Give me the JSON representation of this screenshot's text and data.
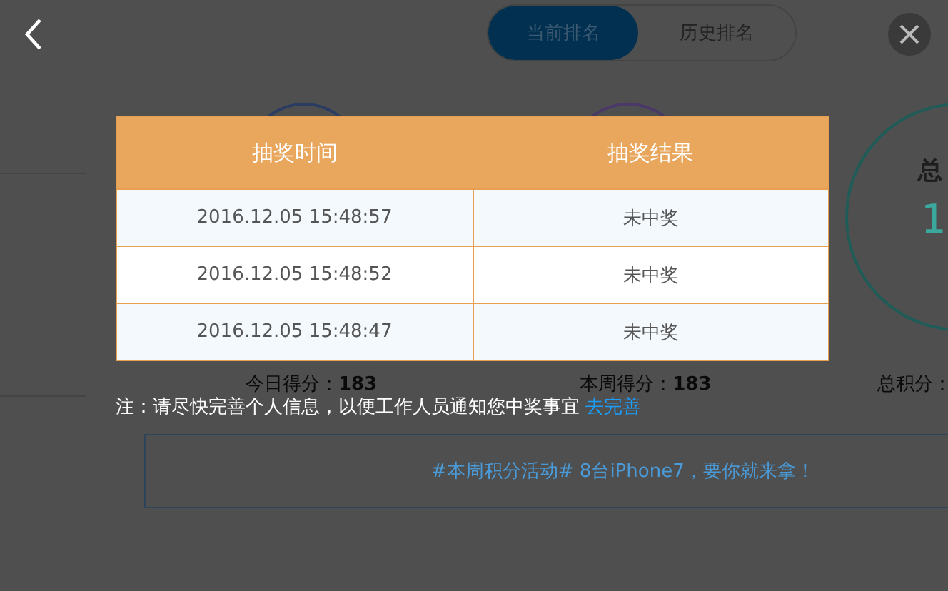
{
  "ranking_tabs": [
    {
      "label": "当前排名",
      "selected": true
    },
    {
      "label": "历史排名",
      "selected": false
    }
  ],
  "total_circle": {
    "label": "总",
    "value": "1"
  },
  "stats": [
    "今日得分：**183**",
    "本周得分：**183**",
    "总积分："
  ],
  "banner": {
    "text": "#本周积分活动# 8台iPhone7，要你就来拿！"
  },
  "dialog": {
    "columns": [
      "抽奖时间",
      "抽奖结果"
    ],
    "rows": [
      {
        "time": "2016.12.05 15:48:57",
        "result": "未中奖"
      },
      {
        "time": "2016.12.05 15:48:52",
        "result": "未中奖"
      },
      {
        "time": "2016.12.05 15:48:47",
        "result": "未中奖"
      }
    ],
    "note": "注：请尽快完善个人信息，以便工作人员通知您中奖事宜",
    "note_link": "去完善"
  }
}
